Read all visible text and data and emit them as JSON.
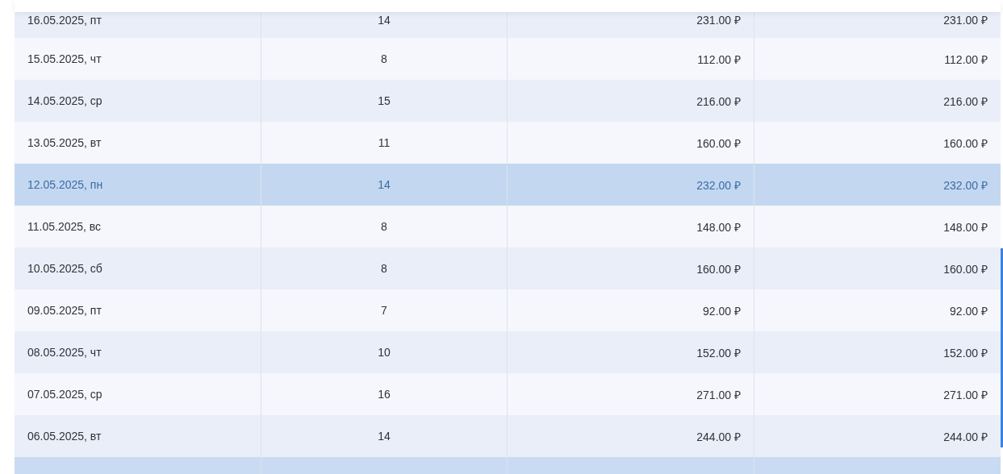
{
  "table": {
    "rows": [
      {
        "date": "16.05.2025, пт",
        "count": "14",
        "amount": "231.00 ₽",
        "total": "231.00 ₽",
        "selected": false
      },
      {
        "date": "15.05.2025, чт",
        "count": "8",
        "amount": "112.00 ₽",
        "total": "112.00 ₽",
        "selected": false
      },
      {
        "date": "14.05.2025, ср",
        "count": "15",
        "amount": "216.00 ₽",
        "total": "216.00 ₽",
        "selected": false
      },
      {
        "date": "13.05.2025, вт",
        "count": "11",
        "amount": "160.00 ₽",
        "total": "160.00 ₽",
        "selected": false
      },
      {
        "date": "12.05.2025, пн",
        "count": "14",
        "amount": "232.00 ₽",
        "total": "232.00 ₽",
        "selected": true
      },
      {
        "date": "11.05.2025, вс",
        "count": "8",
        "amount": "148.00 ₽",
        "total": "148.00 ₽",
        "selected": false
      },
      {
        "date": "10.05.2025, сб",
        "count": "8",
        "amount": "160.00 ₽",
        "total": "160.00 ₽",
        "selected": false
      },
      {
        "date": "09.05.2025, пт",
        "count": "7",
        "amount": "92.00 ₽",
        "total": "92.00 ₽",
        "selected": false
      },
      {
        "date": "08.05.2025, чт",
        "count": "10",
        "amount": "152.00 ₽",
        "total": "152.00 ₽",
        "selected": false
      },
      {
        "date": "07.05.2025, ср",
        "count": "16",
        "amount": "271.00 ₽",
        "total": "271.00 ₽",
        "selected": false
      },
      {
        "date": "06.05.2025, вт",
        "count": "14",
        "amount": "244.00 ₽",
        "total": "244.00 ₽",
        "selected": false
      }
    ]
  }
}
